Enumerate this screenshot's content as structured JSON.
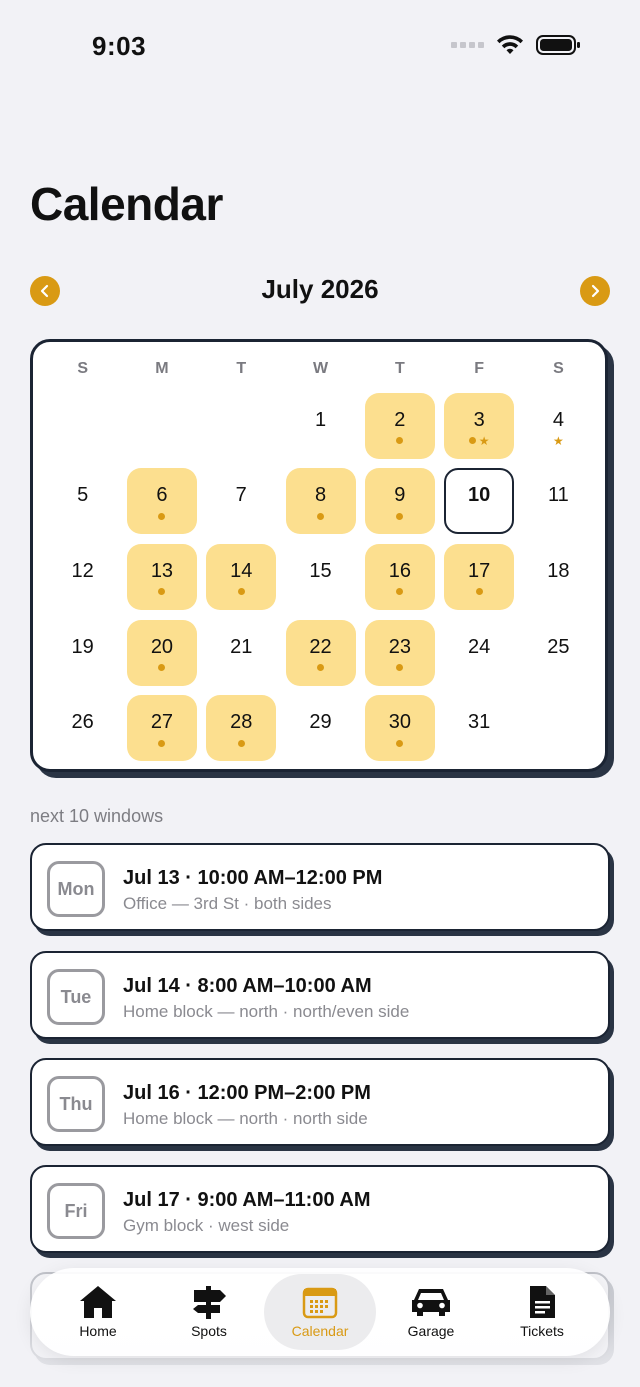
{
  "status_bar": {
    "time": "9:03"
  },
  "header": {
    "title": "Calendar"
  },
  "month_nav": {
    "label": "July 2026"
  },
  "calendar": {
    "weekdays": [
      "S",
      "M",
      "T",
      "W",
      "T",
      "F",
      "S"
    ],
    "weeks": [
      [
        null,
        null,
        null,
        {
          "num": "1"
        },
        {
          "num": "2",
          "hl": true,
          "dot": true
        },
        {
          "num": "3",
          "hl": true,
          "dot": true,
          "star": true
        },
        {
          "num": "4",
          "star": true
        }
      ],
      [
        {
          "num": "5"
        },
        {
          "num": "6",
          "hl": true,
          "dot": true
        },
        {
          "num": "7"
        },
        {
          "num": "8",
          "hl": true,
          "dot": true
        },
        {
          "num": "9",
          "hl": true,
          "dot": true
        },
        {
          "num": "10",
          "today": true
        },
        {
          "num": "11"
        }
      ],
      [
        {
          "num": "12"
        },
        {
          "num": "13",
          "hl": true,
          "dot": true
        },
        {
          "num": "14",
          "hl": true,
          "dot": true
        },
        {
          "num": "15"
        },
        {
          "num": "16",
          "hl": true,
          "dot": true
        },
        {
          "num": "17",
          "hl": true,
          "dot": true
        },
        {
          "num": "18"
        }
      ],
      [
        {
          "num": "19"
        },
        {
          "num": "20",
          "hl": true,
          "dot": true
        },
        {
          "num": "21"
        },
        {
          "num": "22",
          "hl": true,
          "dot": true
        },
        {
          "num": "23",
          "hl": true,
          "dot": true
        },
        {
          "num": "24"
        },
        {
          "num": "25"
        }
      ],
      [
        {
          "num": "26"
        },
        {
          "num": "27",
          "hl": true,
          "dot": true
        },
        {
          "num": "28",
          "hl": true,
          "dot": true
        },
        {
          "num": "29"
        },
        {
          "num": "30",
          "hl": true,
          "dot": true
        },
        {
          "num": "31"
        },
        null
      ]
    ]
  },
  "windows": {
    "label": "next 10 windows",
    "items": [
      {
        "day": "Mon",
        "title": "Jul 13 · 10:00 AM–12:00 PM",
        "subtitle": "Office — 3rd St · both sides"
      },
      {
        "day": "Tue",
        "title": "Jul 14 · 8:00 AM–10:00 AM",
        "subtitle": "Home block — north · north/even side"
      },
      {
        "day": "Thu",
        "title": "Jul 16 · 12:00 PM–2:00 PM",
        "subtitle": "Home block — north · north side"
      },
      {
        "day": "Fri",
        "title": "Jul 17 · 9:00 AM–11:00 AM",
        "subtitle": "Gym block · west side"
      }
    ]
  },
  "tab_bar": {
    "tabs": [
      {
        "label": "Home",
        "icon": "house-icon"
      },
      {
        "label": "Spots",
        "icon": "signpost-icon"
      },
      {
        "label": "Calendar",
        "icon": "calendar-icon",
        "active": true
      },
      {
        "label": "Garage",
        "icon": "car-icon"
      },
      {
        "label": "Tickets",
        "icon": "ticket-doc-icon"
      }
    ]
  },
  "colors": {
    "accent": "#d99a14",
    "highlight": "#fcdf8f",
    "ink": "#1b2433",
    "background": "#f2f2f6"
  }
}
